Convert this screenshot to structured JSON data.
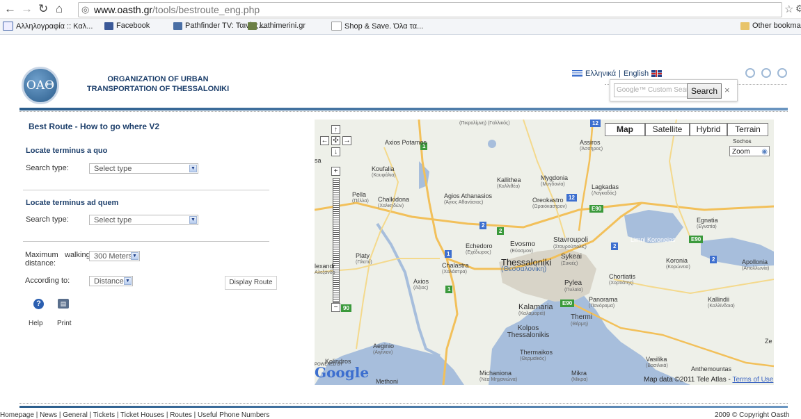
{
  "browser": {
    "url_domain": "www.oasth.gr",
    "url_path": "/tools/bestroute_eng.php",
    "bookmarks": [
      "Αλληλογραφία :: Καλ...",
      "Facebook",
      "Pathfinder TV: Ταινίες...",
      "kathimerini.gr",
      "Shop & Save. Όλα τα...",
      "Other bookmarks"
    ]
  },
  "header": {
    "logo_text": "ΟΑΘ",
    "org_line1": "ORGANIZATION OF URBAN",
    "org_line2": "TRANSPORTATION OF THESSALONIKI",
    "lang_greek": "Ελληνικά",
    "lang_sep": "|",
    "lang_english": "English",
    "search_placeholder": "Google™ Custom Search",
    "search_button": "Search",
    "search_close": "×"
  },
  "form": {
    "title": "Best Route - How to go where V2",
    "from_title": "Locate terminus a quo",
    "to_title": "Locate terminus ad quem",
    "search_type_label": "Search type:",
    "select_type": "Select type",
    "max_walk_label1": "Maximum",
    "max_walk_label2": "walking",
    "max_walk_label3": "distance:",
    "max_walk_value": "300 Meters",
    "according_label": "According to:",
    "according_value": "Distance",
    "display_route": "Display Route",
    "help": "Help",
    "print": "Print"
  },
  "map": {
    "types": [
      "Map",
      "Satellite",
      "Hybrid",
      "Terrain"
    ],
    "zoom_label": "Zoom",
    "labels": {
      "axios_potamos": "Axios Potamos",
      "koufalia": "Koufalia",
      "koufalia_gr": "(Κουφάλια)",
      "pella": "Pella",
      "pella_gr": "(Πέλλα)",
      "chalkidona": "Chalkidona",
      "chalkidona_gr": "(Χαλκηδών)",
      "agios_athanasios": "Agios Athanasios",
      "agios_gr": "(Άγιος Αθανάσιος)",
      "kallithea": "Kallithea",
      "kallithea_gr": "(Καλλιθέα)",
      "mygdonia": "Mygdonia",
      "mygdonia_gr": "(Μυγδονία)",
      "oreokastro": "Oreokastro",
      "oreokastro_gr": "(Ωραιόκαστρον)",
      "lagkadas": "Lagkadas",
      "lagkadas_gr": "(Λαγκαδάς)",
      "assiros": "Assiros",
      "assiros_gr": "(Άσσηρος)",
      "sochos": "Sochos",
      "egnatia": "Egnatia",
      "egnatia_gr": "(Εγνατία)",
      "limni": "Limni Koroneias",
      "koronia": "Koronia",
      "koronia_gr": "(Κορώνεια)",
      "apollonia": "Apollonia",
      "apollonia_gr": "(Απολλωνία)",
      "platy": "Platy",
      "platy_gr": "(Πλατύ)",
      "alexandreia": "lexandr",
      "alexandreia_gr": "Αλεξάνδρ",
      "echedoro": "Echedoro",
      "echedoro_gr": "(Εχέδωρος)",
      "evosmo": "Evosmo",
      "evosmo_gr": "(Εύοσμον)",
      "stavroupoli": "Stavroupoli",
      "stavroupoli_gr": "(Σταυρούπολις)",
      "sykeai": "Sykeai",
      "sykeai_gr": "(Συκιές)",
      "thessaloniki": "Thessaloniki",
      "thessaloniki_gr": "(Θεσσαλονίκη)",
      "chalastra": "Chalastra",
      "chalastra_gr": "(Χαλάστρα)",
      "axios": "Axios",
      "axios_gr": "(Άξιος)",
      "pylea": "Pylea",
      "pylea_gr": "(Πυλαία)",
      "chortiatis": "Chortiatis",
      "chortiatis_gr": "(Χορτιάτης)",
      "panorama": "Panorama",
      "panorama_gr": "(Πανόραμα)",
      "kallindii": "Kallindii",
      "kallindii_gr": "(Καλλίνδοια)",
      "kalamaria": "Kalamaria",
      "kalamaria_gr": "(Καλαμαριά)",
      "thermi": "Thermi",
      "thermi_gr": "(Θέρμη)",
      "kolpos": "Kolpos Thessalonikis",
      "thermaikos": "Thermaikos",
      "thermaikos_gr": "(Θερμαϊκός)",
      "aeginio": "Aeginio",
      "aeginio_gr": "(Αιγίνιον)",
      "kolindros": "Kolindros",
      "methoni": "Methoni",
      "michaniona": "Michaniona",
      "michaniona_gr": "(Νέα Μηχανιώνα)",
      "mikra": "Mikra",
      "mikra_gr": "(Μίκρα)",
      "vasilika": "Vasilika",
      "vasilika_gr": "(Βασιλικά)",
      "anthemountas": "Anthemountas",
      "pikrolimni": "(Πικρολίμνη)",
      "gallikos": "(Γαλλικός)",
      "sa": "sa",
      "ze": "Ze"
    },
    "shields": {
      "e90": "E90",
      "n1": "1",
      "n2": "2",
      "n12": "12",
      "n90": "90"
    },
    "powered_by": "POWERED BY",
    "google": "Google",
    "map_data": "Map data ©2011 Tele Atlas - ",
    "terms": "Terms of Use"
  },
  "footer": {
    "links": "Homepage | News | General | Tickets | Ticket Houses | Routes | Useful Phone Numbers",
    "copyright": "2009 © Copyright Oasth"
  }
}
